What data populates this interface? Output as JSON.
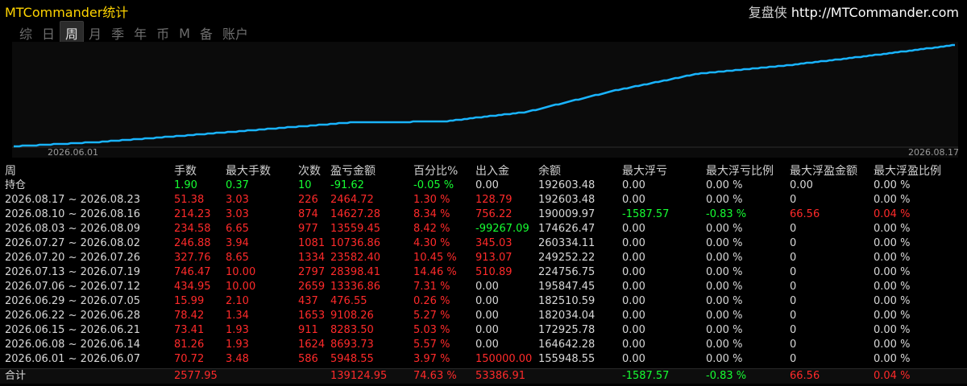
{
  "app": {
    "title": "MTCommander统计",
    "right_label": "复盘侠",
    "right_url": "http://MTCommander.com"
  },
  "tabs": [
    {
      "label": "综"
    },
    {
      "label": "日"
    },
    {
      "label": "周",
      "active": true
    },
    {
      "label": "月"
    },
    {
      "label": "季"
    },
    {
      "label": "年"
    },
    {
      "label": "币"
    },
    {
      "label": "M"
    },
    {
      "label": "备"
    },
    {
      "label": "账户"
    }
  ],
  "chart_data": {
    "type": "line",
    "x": [
      "2026-06-01",
      "2026-06-08",
      "2026-06-15",
      "2026-06-22",
      "2026-06-29",
      "2026-07-06",
      "2026-07-13",
      "2026-07-20",
      "2026-07-27",
      "2026-08-03",
      "2026-08-10",
      "2026-08-17"
    ],
    "values": [
      0,
      5948.55,
      14642.28,
      23925.78,
      33034.04,
      33510.59,
      46847.45,
      75245.86,
      98828.26,
      109564.43,
      123123.98,
      137751.26
    ],
    "x_tick_labels": [
      "2026.06.01",
      "2026.08.17"
    ],
    "line_color": "#19b4ff",
    "grid": false
  },
  "table": {
    "headers": [
      "周",
      "手数",
      "最大手数",
      "次数",
      "盈亏金额",
      "百分比%",
      "出入金",
      "余额",
      "最大浮亏",
      "最大浮亏比例",
      "最大浮盈金额",
      "最大浮盈比例"
    ],
    "holding": {
      "label": "持仓",
      "lots": "1.90",
      "max_lots": "0.37",
      "count": "10",
      "pnl": "-91.62",
      "pct": "-0.05 %",
      "cash": "0.00",
      "balance": "192603.48",
      "max_dd": "0.00",
      "max_dd_pct": "0.00 %",
      "max_fp": "0.00",
      "max_fp_pct": "0.00 %"
    },
    "rows": [
      {
        "week": "2026.08.17 ~ 2026.08.23",
        "lots": "51.38",
        "max_lots": "3.03",
        "count": "226",
        "pnl": "2464.72",
        "pct": "1.30 %",
        "cash": "128.79",
        "balance": "192603.48",
        "max_dd": "0.00",
        "max_dd_pct": "0.00 %",
        "max_fp": "0",
        "max_fp_pct": "0.00 %"
      },
      {
        "week": "2026.08.10 ~ 2026.08.16",
        "lots": "214.23",
        "max_lots": "3.03",
        "count": "874",
        "pnl": "14627.28",
        "pct": "8.34 %",
        "cash": "756.22",
        "balance": "190009.97",
        "max_dd": "-1587.57",
        "max_dd_pct": "-0.83 %",
        "max_fp": "66.56",
        "max_fp_pct": "0.04 %"
      },
      {
        "week": "2026.08.03 ~ 2026.08.09",
        "lots": "234.58",
        "max_lots": "6.65",
        "count": "977",
        "pnl": "13559.45",
        "pct": "8.42 %",
        "cash": "-99267.09",
        "balance": "174626.47",
        "max_dd": "0.00",
        "max_dd_pct": "0.00 %",
        "max_fp": "0",
        "max_fp_pct": "0.00 %"
      },
      {
        "week": "2026.07.27 ~ 2026.08.02",
        "lots": "246.88",
        "max_lots": "3.94",
        "count": "1081",
        "pnl": "10736.86",
        "pct": "4.30 %",
        "cash": "345.03",
        "balance": "260334.11",
        "max_dd": "0.00",
        "max_dd_pct": "0.00 %",
        "max_fp": "0",
        "max_fp_pct": "0.00 %"
      },
      {
        "week": "2026.07.20 ~ 2026.07.26",
        "lots": "327.76",
        "max_lots": "8.65",
        "count": "1334",
        "pnl": "23582.40",
        "pct": "10.45 %",
        "cash": "913.07",
        "balance": "249252.22",
        "max_dd": "0.00",
        "max_dd_pct": "0.00 %",
        "max_fp": "0",
        "max_fp_pct": "0.00 %"
      },
      {
        "week": "2026.07.13 ~ 2026.07.19",
        "lots": "746.47",
        "max_lots": "10.00",
        "count": "2797",
        "pnl": "28398.41",
        "pct": "14.46 %",
        "cash": "510.89",
        "balance": "224756.75",
        "max_dd": "0.00",
        "max_dd_pct": "0.00 %",
        "max_fp": "0",
        "max_fp_pct": "0.00 %"
      },
      {
        "week": "2026.07.06 ~ 2026.07.12",
        "lots": "434.95",
        "max_lots": "10.00",
        "count": "2659",
        "pnl": "13336.86",
        "pct": "7.31 %",
        "cash": "0.00",
        "balance": "195847.45",
        "max_dd": "0.00",
        "max_dd_pct": "0.00 %",
        "max_fp": "0",
        "max_fp_pct": "0.00 %"
      },
      {
        "week": "2026.06.29 ~ 2026.07.05",
        "lots": "15.99",
        "max_lots": "2.10",
        "count": "437",
        "pnl": "476.55",
        "pct": "0.26 %",
        "cash": "0.00",
        "balance": "182510.59",
        "max_dd": "0.00",
        "max_dd_pct": "0.00 %",
        "max_fp": "0",
        "max_fp_pct": "0.00 %"
      },
      {
        "week": "2026.06.22 ~ 2026.06.28",
        "lots": "78.42",
        "max_lots": "1.34",
        "count": "1653",
        "pnl": "9108.26",
        "pct": "5.27 %",
        "cash": "0.00",
        "balance": "182034.04",
        "max_dd": "0.00",
        "max_dd_pct": "0.00 %",
        "max_fp": "0",
        "max_fp_pct": "0.00 %"
      },
      {
        "week": "2026.06.15 ~ 2026.06.21",
        "lots": "73.41",
        "max_lots": "1.93",
        "count": "911",
        "pnl": "8283.50",
        "pct": "5.03 %",
        "cash": "0.00",
        "balance": "172925.78",
        "max_dd": "0.00",
        "max_dd_pct": "0.00 %",
        "max_fp": "0",
        "max_fp_pct": "0.00 %"
      },
      {
        "week": "2026.06.08 ~ 2026.06.14",
        "lots": "81.26",
        "max_lots": "1.93",
        "count": "1624",
        "pnl": "8693.73",
        "pct": "5.57 %",
        "cash": "0.00",
        "balance": "164642.28",
        "max_dd": "0.00",
        "max_dd_pct": "0.00 %",
        "max_fp": "0",
        "max_fp_pct": "0.00 %"
      },
      {
        "week": "2026.06.01 ~ 2026.06.07",
        "lots": "70.72",
        "max_lots": "3.48",
        "count": "586",
        "pnl": "5948.55",
        "pct": "3.97 %",
        "cash": "150000.00",
        "balance": "155948.55",
        "max_dd": "0.00",
        "max_dd_pct": "0.00 %",
        "max_fp": "0",
        "max_fp_pct": "0.00 %"
      }
    ],
    "total": {
      "label": "合计",
      "lots": "2577.95",
      "pnl": "139124.95",
      "pct": "74.63 %",
      "cash": "53386.91",
      "max_dd": "-1587.57",
      "max_dd_pct": "-0.83 %",
      "max_fp": "66.56",
      "max_fp_pct": "0.04 %"
    }
  }
}
